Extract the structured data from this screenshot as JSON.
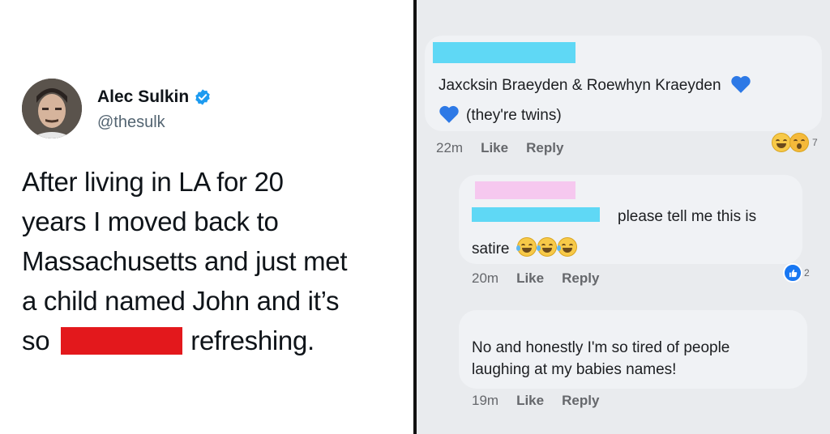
{
  "tweet": {
    "display_name": "Alec Sulkin",
    "handle": "@thesulk",
    "verified_icon": "verified-badge-icon",
    "lines": [
      "After living in LA for 20",
      "years I moved back to",
      "Massachusetts and just met",
      "a child named John and it’s"
    ],
    "last_line_prefix": "so",
    "last_line_suffix": "refreshing.",
    "redaction_color": "#e3181c"
  },
  "comments": [
    {
      "text_line1": "Jaxcksin Braeyden & Roewhyn Kraeyden",
      "text_line2": "(they're twins)",
      "time": "22m",
      "like_label": "Like",
      "reply_label": "Reply",
      "reaction_count": "7"
    },
    {
      "text_line1": "please tell me this is",
      "text_line2": "satire",
      "time": "20m",
      "like_label": "Like",
      "reply_label": "Reply",
      "reaction_count": "2"
    },
    {
      "text_line1": "No and honestly I'm so tired of people",
      "text_line2": "laughing at my babies names!",
      "time": "19m",
      "like_label": "Like",
      "reply_label": "Reply"
    }
  ],
  "colors": {
    "name_redaction": "#5fd8f5",
    "name_redaction_alt": "#f6c8ef",
    "heart": "#2d79e6",
    "like_blue": "#1877f2"
  }
}
